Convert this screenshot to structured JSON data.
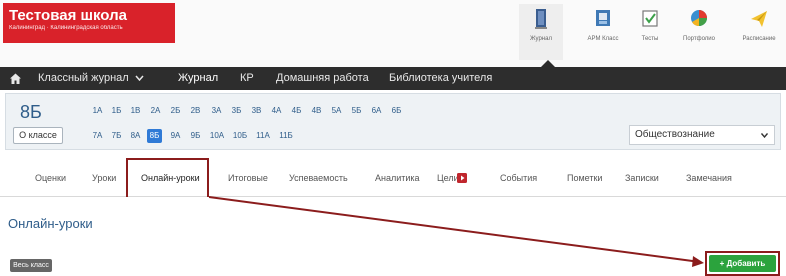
{
  "school": {
    "name": "Тестовая школа",
    "location": "Калининград · Калининградская область"
  },
  "top_nav": [
    {
      "label": "Журнал",
      "icon": "journal-icon",
      "active": true
    },
    {
      "label": "АРМ Класс",
      "icon": "class-workplace-icon",
      "active": false
    },
    {
      "label": "Тесты",
      "icon": "checkbox-icon",
      "active": false
    },
    {
      "label": "Портфолио",
      "icon": "pie-chart-icon",
      "active": false
    },
    {
      "label": "Расписание",
      "icon": "paperplane-icon",
      "active": false
    }
  ],
  "main_nav": {
    "items": [
      {
        "label": "Классный журнал",
        "dropdown": true,
        "active": false
      },
      {
        "label": "Журнал",
        "active": true
      },
      {
        "label": "КР",
        "active": false
      },
      {
        "label": "Домашняя работа",
        "active": false
      },
      {
        "label": "Библиотека учителя",
        "active": false
      }
    ]
  },
  "class_panel": {
    "current_class": "8Б",
    "about_button": "О классе",
    "classes_row1": [
      "1А",
      "1Б",
      "1В",
      "2А",
      "2Б",
      "2В",
      "3А",
      "3Б",
      "3В",
      "4А",
      "4Б",
      "4В",
      "5А",
      "5Б",
      "6А",
      "6Б"
    ],
    "classes_row2": [
      "7А",
      "7Б",
      "8А",
      "8Б",
      "9А",
      "9Б",
      "10А",
      "10Б",
      "11А",
      "11Б"
    ],
    "selected_class": "8Б",
    "subject": "Обществознание"
  },
  "tabs": [
    {
      "label": "Оценки",
      "active": false
    },
    {
      "label": "Уроки",
      "active": false
    },
    {
      "label": "Онлайн-уроки",
      "active": true
    },
    {
      "label": "Итоговые",
      "active": false
    },
    {
      "label": "Успеваемость",
      "active": false
    },
    {
      "label": "Аналитика",
      "active": false
    },
    {
      "label": "Цели",
      "active": false
    },
    {
      "label": "События",
      "active": false
    },
    {
      "label": "Пометки",
      "active": false
    },
    {
      "label": "Записки",
      "active": false
    },
    {
      "label": "Замечания",
      "active": false
    }
  ],
  "page": {
    "section_title": "Онлайн-уроки",
    "all_class_button": "Весь класс",
    "add_button": "+ Добавить"
  },
  "colors": {
    "brand": "#d9222a",
    "nav_dark": "#2d2d2d",
    "selected_class": "#2f7ad6",
    "add_button": "#2ba33d",
    "annotation": "#8b1c1c"
  }
}
